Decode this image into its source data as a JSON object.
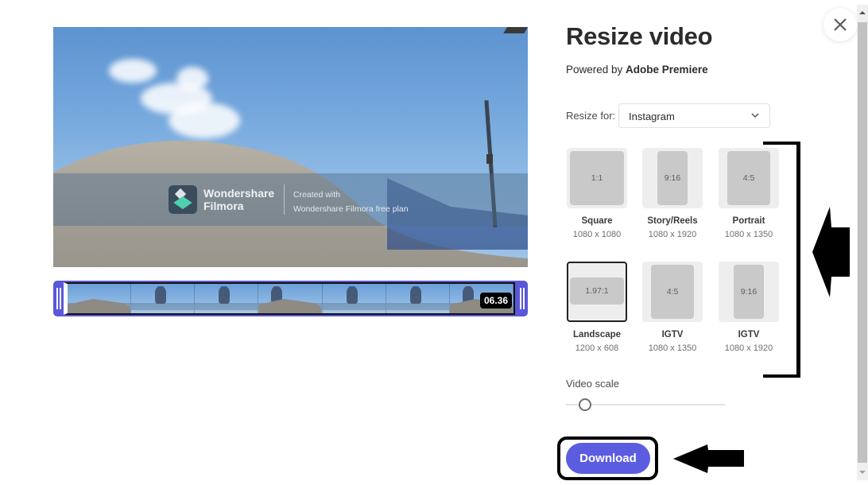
{
  "preview": {
    "watermark": {
      "brand_line1": "Wondershare",
      "brand_line2": "Filmora",
      "created_line1": "Created with",
      "created_line2": "Wondershare Filmora free plan",
      "logo_icon": "filmora-logo-icon"
    }
  },
  "timeline": {
    "duration": "06.36",
    "frame_count": 7,
    "accent_color": "#5a57d9"
  },
  "panel": {
    "title": "Resize video",
    "powered_prefix": "Powered by ",
    "powered_brand": "Adobe Premiere",
    "resize_for_label": "Resize for:",
    "resize_for_value": "Instagram",
    "presets": [
      {
        "ratio": "1:1",
        "name": "Square",
        "dims": "1080 x 1080",
        "selected": false
      },
      {
        "ratio": "9:16",
        "name": "Story/Reels",
        "dims": "1080 x 1920",
        "selected": false
      },
      {
        "ratio": "4:5",
        "name": "Portrait",
        "dims": "1080 x 1350",
        "selected": false
      },
      {
        "ratio": "1.97:1",
        "name": "Landscape",
        "dims": "1200 x 608",
        "selected": true
      },
      {
        "ratio": "4:5",
        "name": "IGTV",
        "dims": "1080 x 1350",
        "selected": false
      },
      {
        "ratio": "9:16",
        "name": "IGTV",
        "dims": "1080 x 1920",
        "selected": false
      }
    ],
    "video_scale_label": "Video scale",
    "video_scale_value_fraction": 0.12,
    "download_label": "Download",
    "accent_color": "#5c5ce0"
  },
  "close_icon": "close-icon"
}
